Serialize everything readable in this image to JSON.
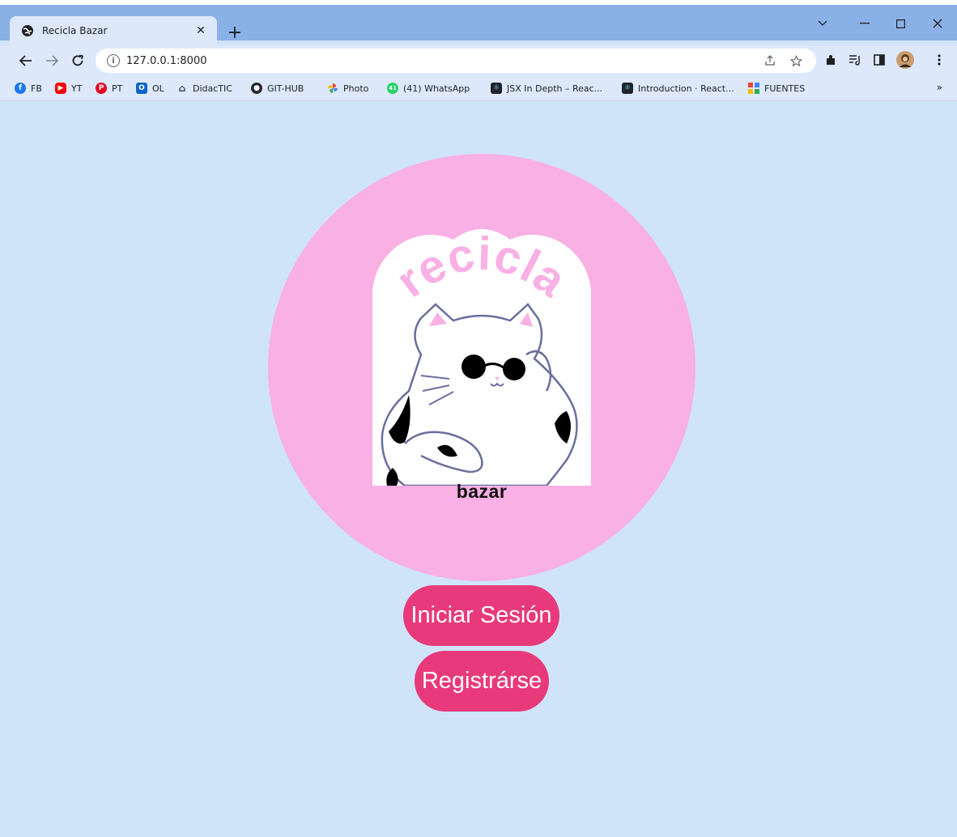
{
  "browser": {
    "tab_title": "Recicla Bazar",
    "tab_close": "✕",
    "new_tab": "+",
    "url": "127.0.0.1:8000",
    "bookmarks": [
      {
        "label": "FB",
        "icon": "facebook-icon",
        "color": "#1877f2"
      },
      {
        "label": "YT",
        "icon": "youtube-icon",
        "color": "#ff0000"
      },
      {
        "label": "PT",
        "icon": "pinterest-icon",
        "color": "#e60023"
      },
      {
        "label": "OL",
        "icon": "outlook-icon",
        "color": "#0a64c8"
      },
      {
        "label": "DidacTIC",
        "icon": "building-icon",
        "color": "#3c4043"
      },
      {
        "label": "GIT-HUB",
        "icon": "github-icon",
        "color": "#24292f"
      },
      {
        "label": "Photo",
        "icon": "pinwheel-icon",
        "color": "#fbbc04"
      },
      {
        "label": "(41) WhatsApp",
        "icon": "whatsapp-icon",
        "color": "#25d366"
      },
      {
        "label": "JSX In Depth – Reac...",
        "icon": "react-icon",
        "color": "#20232a"
      },
      {
        "label": "Introduction · React...",
        "icon": "react-icon",
        "color": "#20232a"
      },
      {
        "label": "FUENTES",
        "icon": "grid-icon",
        "color": "#4285f4"
      }
    ],
    "bookmarks_more": "»"
  },
  "logo": {
    "arc_text": "recicla",
    "bottom_text": "bazar"
  },
  "actions": {
    "login_label": "Iniciar Sesión",
    "register_label": "Registrárse"
  },
  "colors": {
    "page_bg": "#cfe4f8",
    "circle": "#f9b0e4",
    "button": "#e83a7a",
    "cat_outline": "#6b6f9e"
  }
}
